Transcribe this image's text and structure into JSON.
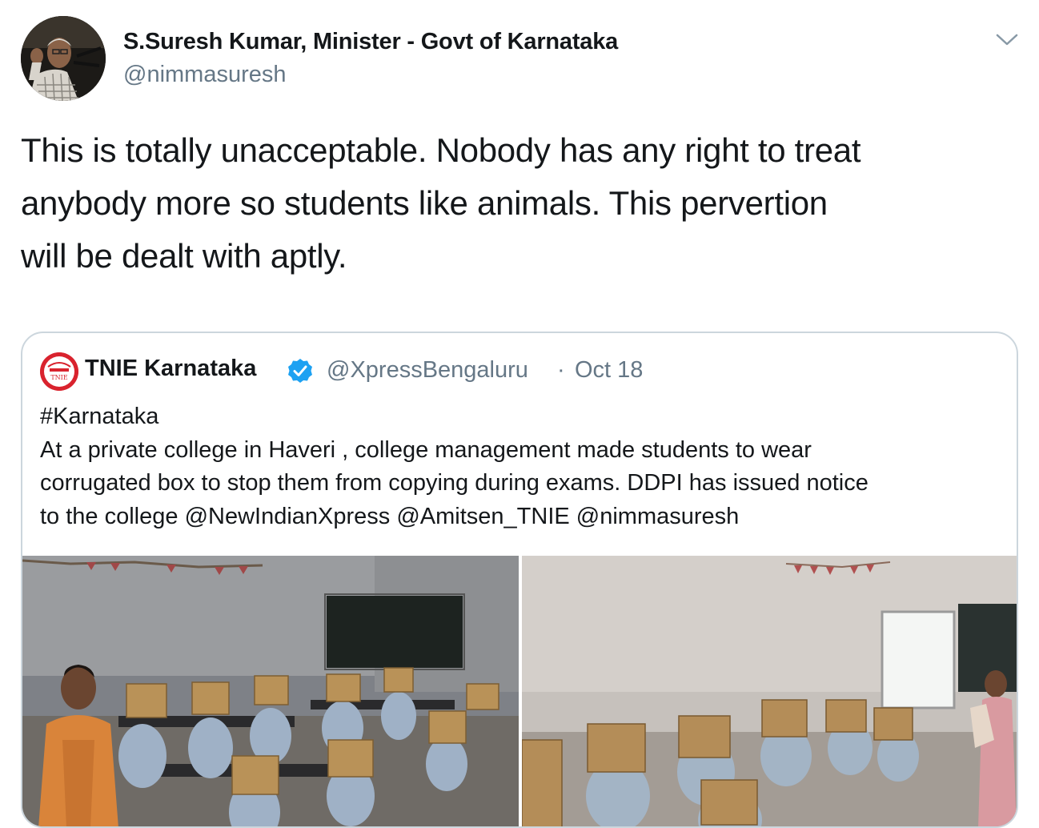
{
  "tweet": {
    "author_name": "S.Suresh Kumar, Minister - Govt of Karnataka",
    "author_handle": "@nimmasuresh",
    "text_lines": [
      "This is totally unacceptable. Nobody has any right to treat",
      "anybody more so students like animals. This pervertion",
      "will be dealt with aptly."
    ],
    "menu_icon": "chevron-down-icon"
  },
  "quoted_tweet": {
    "author_name": "TNIE Karnataka",
    "verified_icon": "verified-badge-icon",
    "author_handle": "@XpressBengaluru",
    "separator": "·",
    "date": "Oct 18",
    "text_lines": [
      "#Karnataka",
      "At a private college in Haveri , college management made students to wear",
      "corrugated box to stop them from copying during exams. DDPI has issued notice",
      "to the college @NewIndianXpress @Amitsen_TNIE @nimmasuresh"
    ],
    "avatar_logo_text": "TNIE"
  },
  "colors": {
    "text": "#14171a",
    "secondary": "#657786",
    "border": "#ccd6dd",
    "verified": "#1da1f2"
  }
}
